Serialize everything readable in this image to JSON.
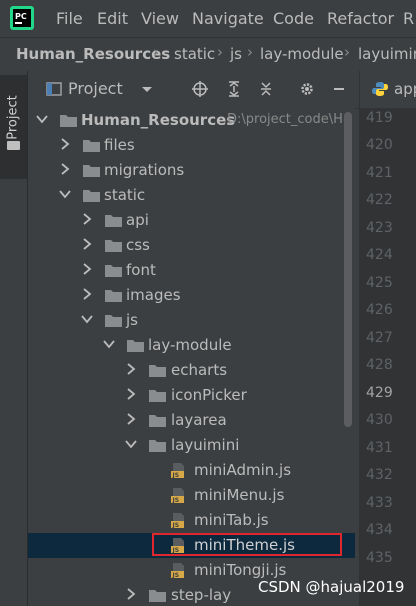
{
  "menubar": {
    "logo_text": "PC",
    "items": [
      "File",
      "Edit",
      "View",
      "Navigate",
      "Code",
      "Refactor",
      "R"
    ]
  },
  "breadcrumb": [
    "Human_Resources",
    "static",
    "js",
    "lay-module",
    "layuimini"
  ],
  "toolstrip": {
    "project_label": "Project"
  },
  "project_header": {
    "title": "Project"
  },
  "tree": {
    "root_label": "Human_Resources",
    "root_path": "D:\\project_code\\H",
    "rows": [
      {
        "label": "files"
      },
      {
        "label": "migrations"
      },
      {
        "label": "static"
      },
      {
        "label": "api"
      },
      {
        "label": "css"
      },
      {
        "label": "font"
      },
      {
        "label": "images"
      },
      {
        "label": "js"
      },
      {
        "label": "lay-module"
      },
      {
        "label": "echarts"
      },
      {
        "label": "iconPicker"
      },
      {
        "label": "layarea"
      },
      {
        "label": "layuimini"
      },
      {
        "label": "miniAdmin.js"
      },
      {
        "label": "miniMenu.js"
      },
      {
        "label": "miniTab.js"
      },
      {
        "label": "miniTheme.js"
      },
      {
        "label": "miniTongji.js"
      },
      {
        "label": "step-lay"
      }
    ]
  },
  "editor": {
    "tab_label": "app",
    "line_numbers": [
      "419",
      "420",
      "421",
      "422",
      "423",
      "424",
      "425",
      "426",
      "427",
      "428",
      "429",
      "430",
      "431",
      "432",
      "433",
      "434",
      "435"
    ]
  },
  "colors": {
    "selected_row": "#0d293e",
    "highlight_box": "#e0262e",
    "folder": "#8a8d90",
    "js_icon": "#d6a847"
  },
  "watermark": "CSDN @hajual2019"
}
